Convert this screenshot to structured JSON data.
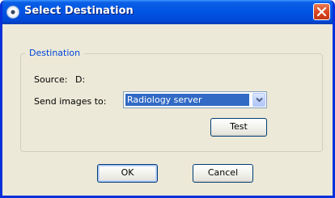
{
  "window": {
    "title": "Select Destination"
  },
  "group": {
    "legend": "Destination"
  },
  "source": {
    "label": "Source:",
    "value": "D:"
  },
  "send": {
    "label": "Send images to:",
    "selected": "Radiology server"
  },
  "buttons": {
    "test": "Test",
    "ok": "OK",
    "cancel": "Cancel"
  },
  "icons": {
    "title": "app-icon",
    "close": "close-icon",
    "dropdown": "chevron-down-icon"
  },
  "colors": {
    "titlebar": "#0054e3",
    "frame": "#0831d9",
    "dialog_bg": "#ece9d8",
    "legend_text": "#0046d5",
    "selection": "#316ac5",
    "close_button": "#d9451f"
  }
}
